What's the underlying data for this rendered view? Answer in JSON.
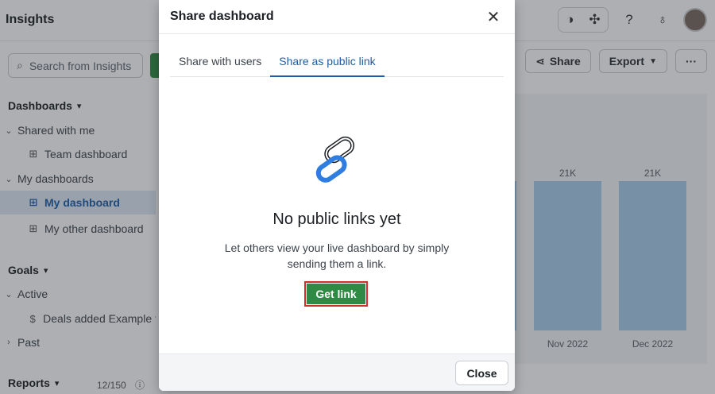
{
  "app": {
    "title": "Insights"
  },
  "search": {
    "placeholder": "Search from Insights"
  },
  "sidebar": {
    "dashboards_title": "Dashboards",
    "shared_with_me": "Shared with me",
    "team_dashboard": "Team dashboard",
    "my_dashboards": "My dashboards",
    "my_dashboard": "My dashboard",
    "my_other_dashboard": "My other dashboard",
    "goals_title": "Goals",
    "active": "Active",
    "deals_added": "Deals added Example t...",
    "past": "Past",
    "reports_title": "Reports",
    "reports_count": "12/150"
  },
  "toolbar": {
    "share_label": "Share",
    "export_label": "Export",
    "more_label": "···"
  },
  "chart_data": {
    "type": "bar",
    "categories": [
      "Nov 2022",
      "Dec 2022"
    ],
    "values": [
      21000,
      21000
    ],
    "data_labels": [
      "21K",
      "21K"
    ]
  },
  "modal": {
    "title": "Share dashboard",
    "tabs": [
      {
        "label": "Share with users",
        "active": false
      },
      {
        "label": "Share as public link",
        "active": true
      }
    ],
    "empty_title": "No public links yet",
    "empty_desc": "Let others view your live dashboard by simply sending them a link.",
    "get_link_label": "Get link",
    "close_label": "Close"
  },
  "colors": {
    "accent_blue": "#1d5ca8",
    "primary_green": "#2f8a43",
    "highlight_red": "#d62b2b",
    "bar_blue": "#a8cdea"
  }
}
